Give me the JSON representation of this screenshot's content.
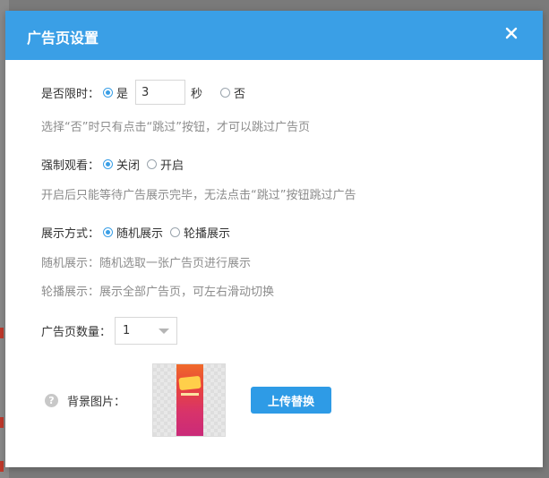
{
  "modal": {
    "title": "广告页设置",
    "close_icon": "close-icon"
  },
  "time_limit": {
    "label": "是否限时：",
    "option_yes": "是",
    "option_no": "否",
    "selected": "是",
    "seconds_value": "3",
    "seconds_unit": "秒",
    "hint": "选择“否”时只有点击“跳过”按钮，才可以跳过广告页"
  },
  "force_watch": {
    "label": "强制观看：",
    "option_off": "关闭",
    "option_on": "开启",
    "selected": "关闭",
    "hint": "开启后只能等待广告展示完毕，无法点击“跳过”按钮跳过广告"
  },
  "display_mode": {
    "label": "展示方式：",
    "option_random": "随机展示",
    "option_carousel": "轮播展示",
    "selected": "随机展示",
    "hint_random": "随机展示：随机选取一张广告页进行展示",
    "hint_carousel": "轮播展示：展示全部广告页，可左右滑动切换"
  },
  "ad_count": {
    "label": "广告页数量：",
    "value": "1"
  },
  "background": {
    "label": "背景图片：",
    "help_icon": "question-circle-icon",
    "upload_label": "上传替换"
  },
  "colors": {
    "header": "#3a9fe6",
    "accent": "#2e9be6",
    "hint_text": "#8c8c8c"
  }
}
